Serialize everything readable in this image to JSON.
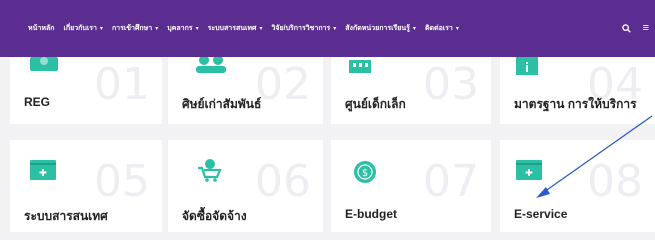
{
  "nav": {
    "items": [
      {
        "label": "หน้าหลัก",
        "dropdown": false
      },
      {
        "label": "เกี่ยวกับเรา",
        "dropdown": true
      },
      {
        "label": "การเข้าศึกษา",
        "dropdown": true
      },
      {
        "label": "บุคลากร",
        "dropdown": true
      },
      {
        "label": "ระบบสารสนเทศ",
        "dropdown": true
      },
      {
        "label": "วิจัย/บริการวิชาการ",
        "dropdown": true
      },
      {
        "label": "สังกัดหน่วยการเรียนรู้",
        "dropdown": true
      },
      {
        "label": "ติดต่อเรา",
        "dropdown": true
      }
    ],
    "background": "#5c2d91"
  },
  "tiles": [
    {
      "num": "01",
      "label": "REG",
      "icon": "users-support-icon",
      "color": "#2bbfa4"
    },
    {
      "num": "02",
      "label": "ศิษย์เก่าสัมพันธ์",
      "icon": "alumni-people-icon",
      "color": "#2bbfa4"
    },
    {
      "num": "03",
      "label": "ศูนย์เด็กเล็ก",
      "icon": "building-icon",
      "color": "#2bbfa4"
    },
    {
      "num": "04",
      "label": "มาตรฐาน การให้บริการ",
      "icon": "standard-info-icon",
      "color": "#2bbfa4"
    },
    {
      "num": "05",
      "label": "ระบบสารสนเทศ",
      "icon": "card-add-icon",
      "color": "#2bbfa4"
    },
    {
      "num": "06",
      "label": "จัดซื้อจัดจ้าง",
      "icon": "shopping-cart-icon",
      "color": "#2bbfa4"
    },
    {
      "num": "07",
      "label": "E-budget",
      "icon": "coin-icon",
      "color": "#2bbfa4"
    },
    {
      "num": "08",
      "label": "E-service",
      "icon": "card-add-icon",
      "color": "#2bbfa4"
    }
  ],
  "annotation": {
    "arrow_color": "#2a5cc4"
  }
}
